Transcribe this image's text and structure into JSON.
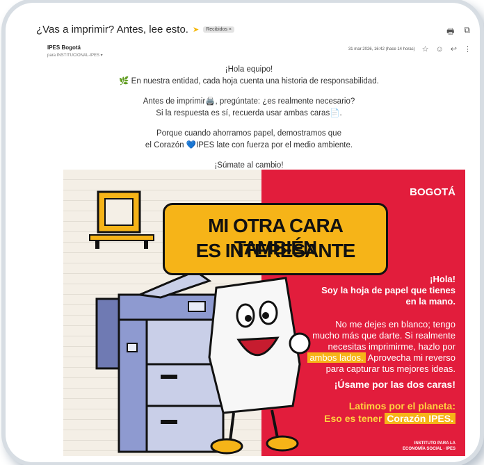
{
  "email": {
    "subject": "¿Vas a imprimir? Antes, lee esto.",
    "label": "Recibidos ×",
    "sender": "IPES Bogotá",
    "to": "para INSTITUCIONAL-IPES ▾",
    "date": "31 mar 2026, 16:42 (hace 14 horas)",
    "greeting": "¡Hola equipo!",
    "line1": "🌿 En nuestra entidad, cada hoja cuenta una historia de responsabilidad.",
    "line2": "Antes de imprimir🖨️, pregúntate: ¿es realmente necesario?",
    "line3": "Si la respuesta es sí, recuerda usar ambas caras📄.",
    "line4": "Porque cuando ahorramos papel, demostramos que",
    "line5": "el Corazón 💙IPES late con fuerza por el medio ambiente.",
    "line6": "¡Súmate al cambio!"
  },
  "poster": {
    "brand": "BOGOTÁ",
    "headline1": "MI OTRA CARA TAMBIÉN",
    "headline2": "ES INTERESANTE",
    "p1a": "¡Hola!",
    "p1b": "Soy la hoja de papel que tienes",
    "p1c": "en la mano.",
    "p2a": "No me dejes en blanco; tengo",
    "p2b": "mucho más que darte. Si realmente",
    "p2c": "necesitas imprimirme, hazlo por",
    "p2d_hl": "ambos lados.",
    "p2d": " Aprovecha mi reverso",
    "p2e": "para capturar tus mejores ideas.",
    "p3": "¡Úsame por las dos caras!",
    "p4": "Latimos por el planeta:",
    "p5": "Eso es tener ",
    "p5_hl": "Corazón IPES.",
    "footer1": "INSTITUTO PARA LA",
    "footer2": "ECONOMÍA SOCIAL · IPES"
  },
  "colors": {
    "red": "#e21d3c",
    "yellow": "#f6b418",
    "paper": "#f4efe6"
  },
  "icons": [
    "printer-icon",
    "open-new-window-icon",
    "star-icon",
    "emoji-icon",
    "reply-icon",
    "more-icon"
  ]
}
